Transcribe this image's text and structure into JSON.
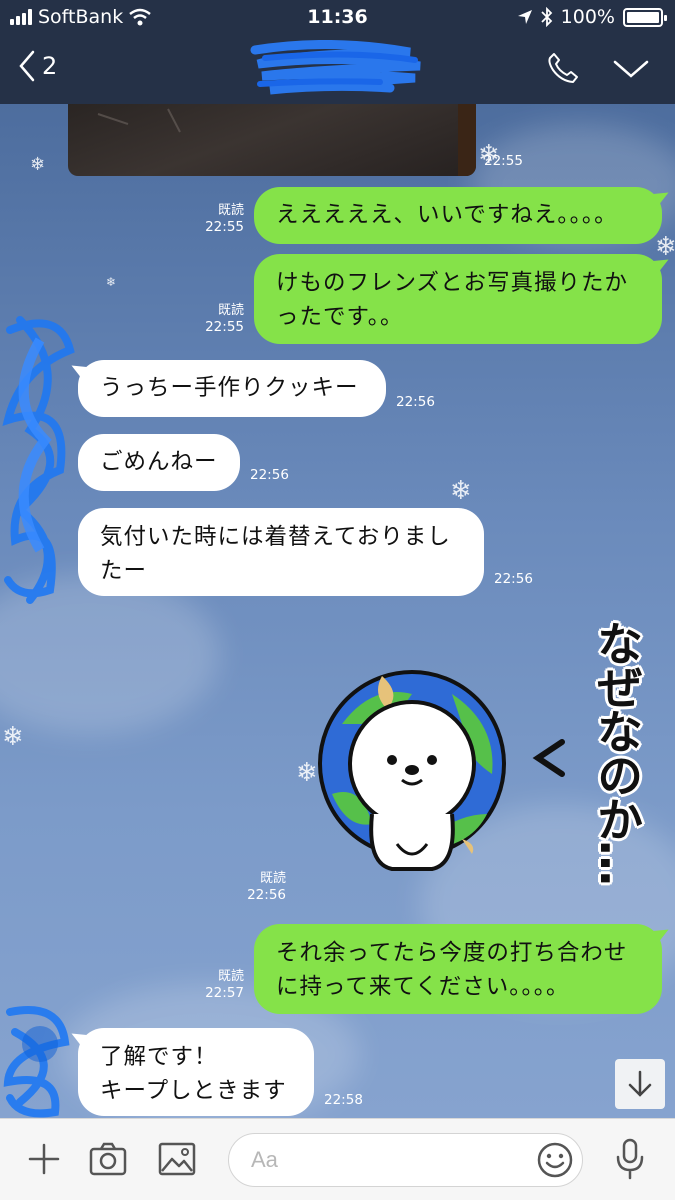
{
  "status_bar": {
    "carrier": "SoftBank",
    "time": "11:36",
    "battery": "100%",
    "icons": [
      "signal-icon",
      "wifi-icon",
      "location-icon",
      "bluetooth-icon",
      "battery-icon"
    ]
  },
  "header": {
    "back_count": "2",
    "title": "",
    "icons": [
      "chevron-left-icon",
      "phone-icon",
      "chevron-down-icon"
    ]
  },
  "messages": [
    {
      "side": "in",
      "kind": "image",
      "time": "22:55"
    },
    {
      "side": "out",
      "text_lines": [
        "えええええ、いいですねえ。。。。"
      ],
      "read": "既読",
      "time": "22:55"
    },
    {
      "side": "out",
      "text_lines": [
        "けものフレンズとお写真撮りたか",
        "ったです。。"
      ],
      "read": "既読",
      "time": "22:55"
    },
    {
      "side": "in",
      "text_lines": [
        "うっちー手作りクッキー"
      ],
      "time": "22:56"
    },
    {
      "side": "in",
      "text_lines": [
        "ごめんねー"
      ],
      "time": "22:56"
    },
    {
      "side": "in",
      "text_lines": [
        "気付いた時には着替えておりまし",
        "たー"
      ],
      "time": "22:56"
    },
    {
      "side": "out",
      "kind": "sticker",
      "sticker_text": "なぜなのか…",
      "read": "既読",
      "time": "22:56"
    },
    {
      "side": "out",
      "text_lines": [
        "それ余ってたら今度の打ち合わせ",
        "に持って来てください。。。。"
      ],
      "read": "既読",
      "time": "22:57"
    },
    {
      "side": "in",
      "text_lines": [
        "了解です！",
        "キープしときます"
      ],
      "time": "22:58"
    }
  ],
  "footer": {
    "input_placeholder": "Aa",
    "icons": [
      "plus-icon",
      "camera-icon",
      "image-icon",
      "emoji-icon",
      "microphone-icon"
    ]
  },
  "colors": {
    "header_bg": "#253147",
    "chat_bg": "#6f8fbf",
    "outgoing_bubble": "#85e249",
    "incoming_bubble": "#ffffff",
    "footer_bg": "#f6f6f6"
  }
}
